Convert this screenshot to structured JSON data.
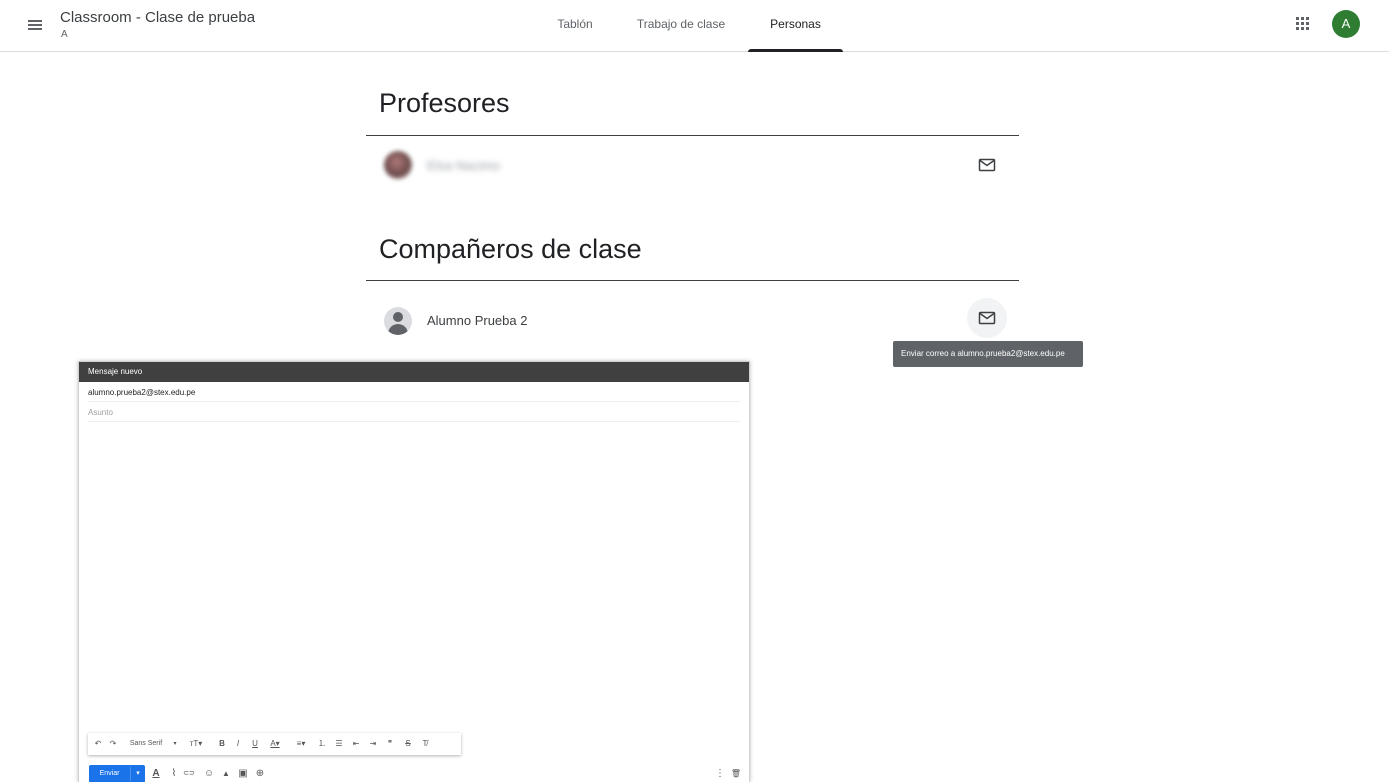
{
  "header": {
    "class_title": "Classroom - Clase de prueba",
    "class_section": "A",
    "tabs": [
      {
        "label": "Tablón",
        "active": false
      },
      {
        "label": "Trabajo de clase",
        "active": false
      },
      {
        "label": "Personas",
        "active": true
      }
    ],
    "account_initial": "A",
    "account_color": "#2e7d32"
  },
  "teachers": {
    "title": "Profesores",
    "people": [
      {
        "name": "Elsa Nacimo",
        "blurred": true
      }
    ]
  },
  "classmates": {
    "title": "Compañeros de clase",
    "people": [
      {
        "name": "Alumno Prueba 2",
        "blurred": false
      }
    ]
  },
  "tooltip": {
    "text": "Enviar correo a alumno.prueba2@stex.edu.pe"
  },
  "compose": {
    "title": "Mensaje nuevo",
    "to": "alumno.prueba2@stex.edu.pe",
    "subject_placeholder": "Asunto",
    "toolbar": {
      "undo": "↶",
      "redo": "↷",
      "font": "Sans Serif",
      "font_caret": "▾",
      "size": "ᴛT▾",
      "bold": "B",
      "italic": "I",
      "underline": "U",
      "text_color": "A▾",
      "align": "≡▾",
      "numbered_list": "⒈",
      "bulleted_list": "☰",
      "indent_less": "⇤",
      "indent_more": "⇥",
      "quote": "❞",
      "strikethrough": "S",
      "clear_format": "T̸"
    },
    "send_label": "Enviar",
    "send_more": "▾",
    "bottom_icons": {
      "formatting": "A",
      "attach": "⌇",
      "link": "⊂⊃",
      "emoji": "☺",
      "drive": "▲",
      "photo": "▣",
      "confidential": "⊕",
      "more": "⋮",
      "discard": "🗑"
    },
    "accent_color": "#1a73e8",
    "header_color": "#404040"
  }
}
